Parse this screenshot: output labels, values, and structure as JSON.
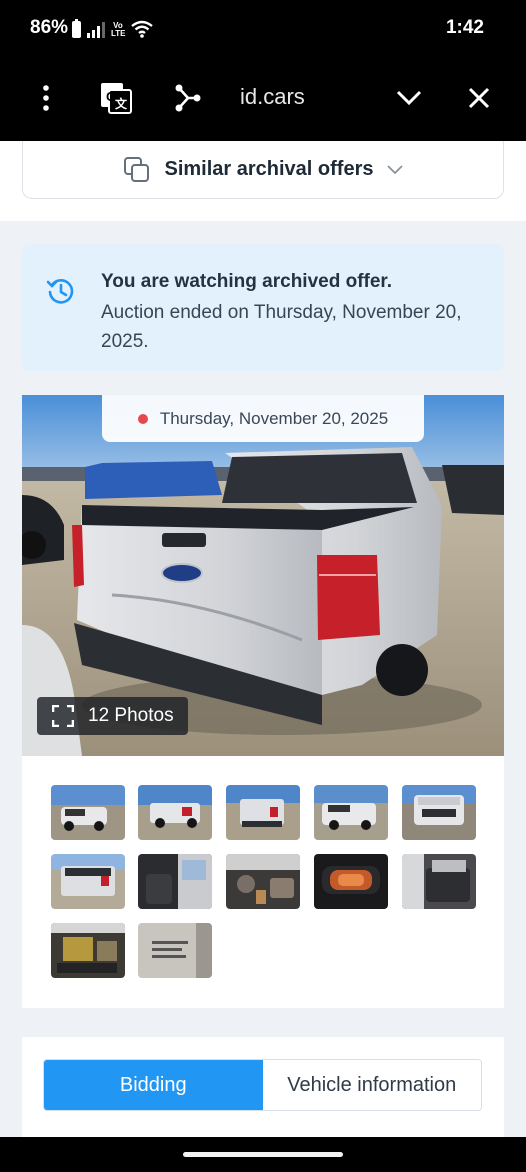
{
  "status_bar": {
    "battery": "86%",
    "volte": "Vo LTE",
    "time": "1:42"
  },
  "browser": {
    "url": "id.cars",
    "icons": [
      "menu-dots-icon",
      "translate-icon",
      "share-icon",
      "chevron-down-icon",
      "close-icon"
    ]
  },
  "similar": {
    "label": "Similar archival offers"
  },
  "archived": {
    "title": "You are watching archived offer.",
    "detail": "Auction ended on Thursday, November 20, 2025."
  },
  "gallery": {
    "date": "Thursday, November 20, 2025",
    "photos_label": "12 Photos",
    "thumbnails": [
      "exterior-front-left",
      "exterior-rear-right",
      "exterior-rear",
      "exterior-front-right",
      "exterior-front",
      "exterior-rear-far",
      "interior-driver",
      "interior-dashboard",
      "instrument-cluster",
      "interior-rear",
      "engine-bay",
      "vin-label"
    ]
  },
  "tabs": {
    "bidding": "Bidding",
    "vehicle_info": "Vehicle information"
  },
  "colors": {
    "accent": "#2196f3",
    "info_bg": "#e3f1fc",
    "live_dot": "#e5484d"
  }
}
